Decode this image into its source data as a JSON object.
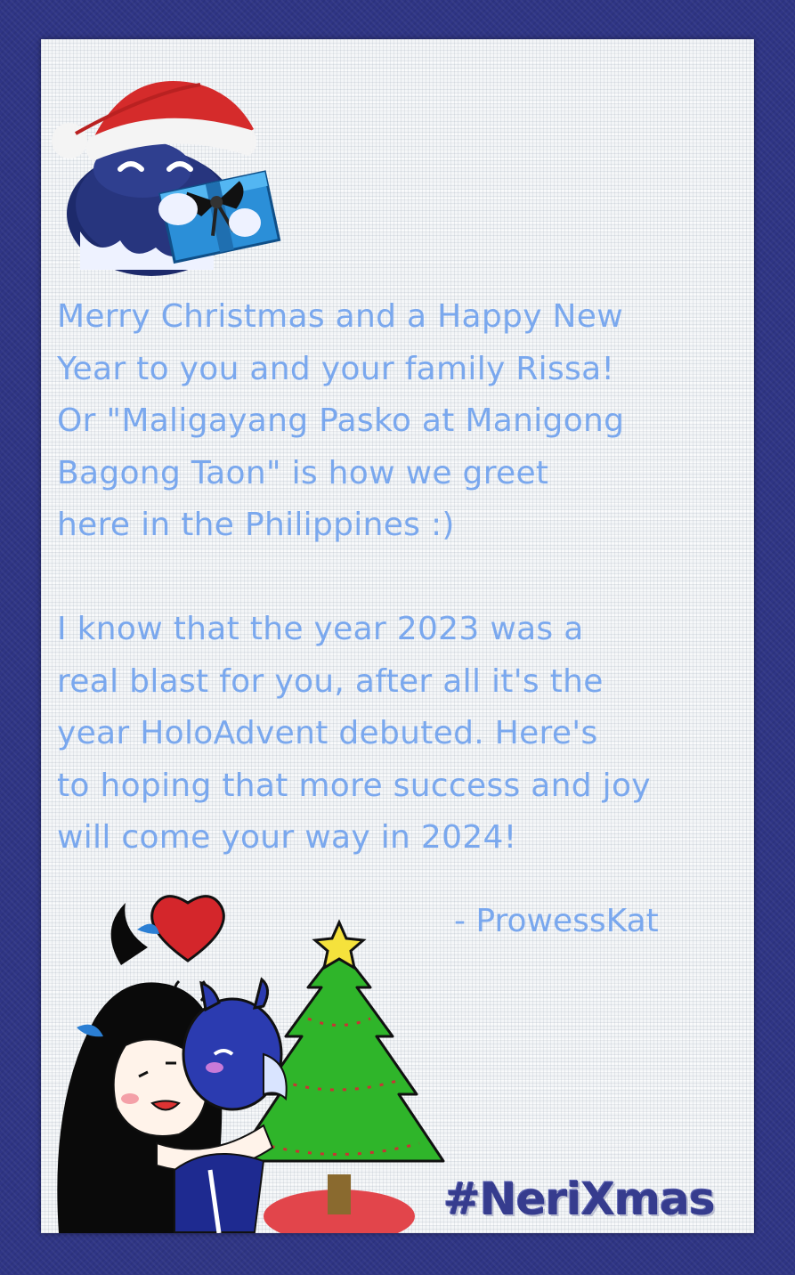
{
  "card": {
    "message_lines": [
      "Merry Christmas and a Happy New",
      "Year to you and your family Rissa!",
      "Or \"Maligayang Pasko at Manigong",
      "Bagong Taon\" is how we greet",
      "here in the Philippines :)",
      "",
      "I know that the year 2023 was a",
      "real blast for you, after all it's the",
      "year HoloAdvent debuted. Here's",
      "to hoping that more success and joy",
      "will come your way in 2024!"
    ],
    "signature": "- ProwessKat",
    "hashtag": "#NeriXmas"
  },
  "colors": {
    "frame": "#2f3585",
    "paper": "#f3f5f7",
    "text": "#7aa8ee",
    "hashtag": "#363c8e"
  },
  "illustrations": {
    "top": "mascot-with-santa-hat-and-gift-icon",
    "bottom_left": "girl-hugging-mascot-icon",
    "heart": "heart-icon",
    "tree": "christmas-tree-icon",
    "star": "star-icon"
  }
}
